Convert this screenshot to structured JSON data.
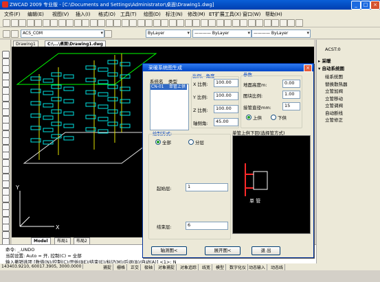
{
  "window": {
    "title": "ZWCAD 2009 专业版 - [C:\\Documents and Settings\\Administrator\\桌面\\Drawing1.dwg]"
  },
  "menu": [
    "文件(F)",
    "编辑(E)",
    "视图(V)",
    "插入(I)",
    "格式(O)",
    "工具(T)",
    "绘图(D)",
    "标注(N)",
    "修改(M)",
    "ET扩展工具(X)",
    "窗口(W)",
    "帮助(H)"
  ],
  "toolbar": {
    "layer": "ACS_COM",
    "color": "ByLayer",
    "linetype": "———— ByLayer",
    "lineweight": "———— ByLayer"
  },
  "doc_tabs": [
    "Drawing1",
    "C:\\...\\桌面\\Drawing1.dwg"
  ],
  "layout_tabs": [
    "Model",
    "布局1",
    "布局2"
  ],
  "command": {
    "line1": "命令: _.UNDO",
    "line2": "当前设置: Auto = 开, 控制(C) = 全部",
    "line3": "输入撤销选项 [数值(N)/控制(C)/开始(BE)/结束(E)/标记(M)/后退(B)/自动(A)] <1>: N"
  },
  "status": {
    "coords": "143403.9210,  60017.3905,  3000.0000",
    "toggles": [
      "捕捉",
      "栅格",
      "正交",
      "极轴",
      "对象捕捉",
      "对象追踪",
      "线宽",
      "模型",
      "数字化仪",
      "动态输入",
      "动态线"
    ]
  },
  "task_panel": {
    "top_item": "ACST:0",
    "sections": [
      {
        "name": "采暖",
        "expanded": false
      },
      {
        "name": "自动系统图",
        "expanded": true
      }
    ],
    "items": [
      "绘系统图",
      "替换散热器",
      "立管加阀",
      "立管移动",
      "立管调阀",
      "自动断线",
      "立管修正"
    ]
  },
  "dialog": {
    "title": "采暖系统图生成",
    "list_headers": [
      "系统名",
      "类型"
    ],
    "list_rows": [
      {
        "name": "CN-01",
        "type": "单管上供"
      }
    ],
    "scale_group": "比例、角度",
    "x_label": "X 比例:",
    "x_value": "100.00",
    "y_label": "Y 比例:",
    "y_value": "100.00",
    "z_label": "Z 比例:",
    "z_value": "100.00",
    "angle_label": "轴侧角:",
    "angle_value": "45.00",
    "param_group": "参数",
    "floor_height_label": "地面高度m:",
    "floor_height_value": "0.00",
    "block_scale_label": "图块比例:",
    "block_scale_value": "1.00",
    "pipe_dia_label": "接管直径mm:",
    "pipe_dia_value": "15",
    "supply_up": "上供",
    "supply_down": "下供",
    "draw_mode_group": "绘制方式:",
    "mode_all": "全部",
    "mode_layer": "分层",
    "preview_label": "单管上供下回(选择管方式)",
    "preview_text": "单  管",
    "start_layer_label": "起始层:",
    "start_layer_value": "1",
    "end_layer_label": "结束层:",
    "end_layer_value": "6",
    "btn_axis": "轴测图<",
    "btn_expand": "展开图<",
    "btn_exit": "退  出"
  },
  "colors": {
    "drawing_cyan": "#00e5e5",
    "drawing_green": "#00ff00",
    "drawing_yellow": "#e5e500",
    "preview_red": "#ff2a2a"
  }
}
